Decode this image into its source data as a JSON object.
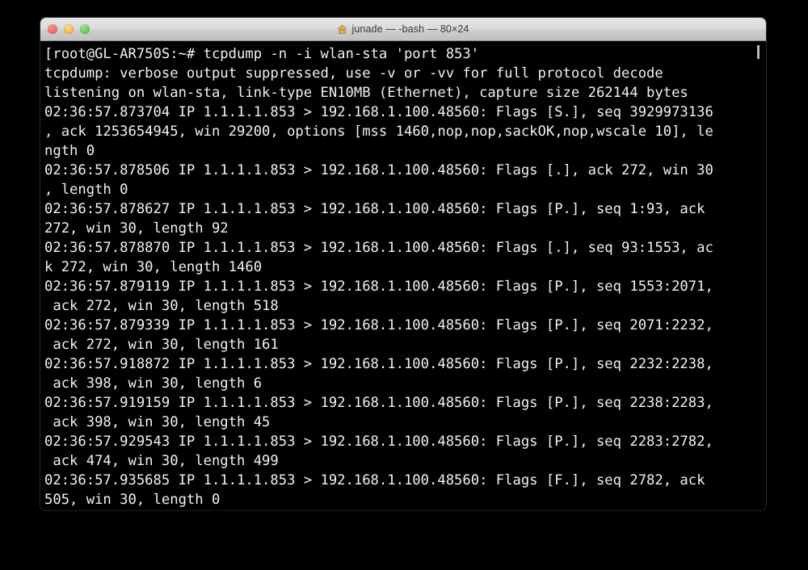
{
  "window": {
    "title": "junade — -bash — 80×24",
    "title_icon": "home-icon",
    "columns": 80,
    "rows": 24,
    "controls": {
      "close_label": "",
      "minimize_label": "",
      "zoom_label": ""
    }
  },
  "colors": {
    "terminal_background": "#000000",
    "terminal_foreground": "#f2f2f2",
    "titlebar_top": "#e4e4e4",
    "titlebar_bottom": "#bfbfbf",
    "traffic_close": "#ee6a5f",
    "traffic_minimize": "#f6bd42",
    "traffic_zoom": "#62c554",
    "desktop_background": "#000000"
  },
  "terminal": {
    "prompt": "root@GL-AR750S:~#",
    "command": "tcpdump -n -i wlan-sta 'port 853'",
    "lines": [
      "[root@GL-AR750S:~# tcpdump -n -i wlan-sta 'port 853'",
      "tcpdump: verbose output suppressed, use -v or -vv for full protocol decode",
      "listening on wlan-sta, link-type EN10MB (Ethernet), capture size 262144 bytes",
      "02:36:57.873704 IP 1.1.1.1.853 > 192.168.1.100.48560: Flags [S.], seq 3929973136",
      ", ack 1253654945, win 29200, options [mss 1460,nop,nop,sackOK,nop,wscale 10], le",
      "ngth 0",
      "02:36:57.878506 IP 1.1.1.1.853 > 192.168.1.100.48560: Flags [.], ack 272, win 30",
      ", length 0",
      "02:36:57.878627 IP 1.1.1.1.853 > 192.168.1.100.48560: Flags [P.], seq 1:93, ack",
      "272, win 30, length 92",
      "02:36:57.878870 IP 1.1.1.1.853 > 192.168.1.100.48560: Flags [.], seq 93:1553, ac",
      "k 272, win 30, length 1460",
      "02:36:57.879119 IP 1.1.1.1.853 > 192.168.1.100.48560: Flags [P.], seq 1553:2071,",
      " ack 272, win 30, length 518",
      "02:36:57.879339 IP 1.1.1.1.853 > 192.168.1.100.48560: Flags [P.], seq 2071:2232,",
      " ack 272, win 30, length 161",
      "02:36:57.918872 IP 1.1.1.1.853 > 192.168.1.100.48560: Flags [P.], seq 2232:2238,",
      " ack 398, win 30, length 6",
      "02:36:57.919159 IP 1.1.1.1.853 > 192.168.1.100.48560: Flags [P.], seq 2238:2283,",
      " ack 398, win 30, length 45",
      "02:36:57.929543 IP 1.1.1.1.853 > 192.168.1.100.48560: Flags [P.], seq 2283:2782,",
      " ack 474, win 30, length 499",
      "02:36:57.935685 IP 1.1.1.1.853 > 192.168.1.100.48560: Flags [F.], seq 2782, ack",
      "505, win 30, length 0"
    ],
    "capture": {
      "interface": "wlan-sta",
      "filter": "port 853",
      "link_type": "EN10MB (Ethernet)",
      "capture_size_bytes": "262144",
      "source_endpoint": "1.1.1.1.853",
      "destination_endpoint": "192.168.1.100.48560"
    }
  }
}
